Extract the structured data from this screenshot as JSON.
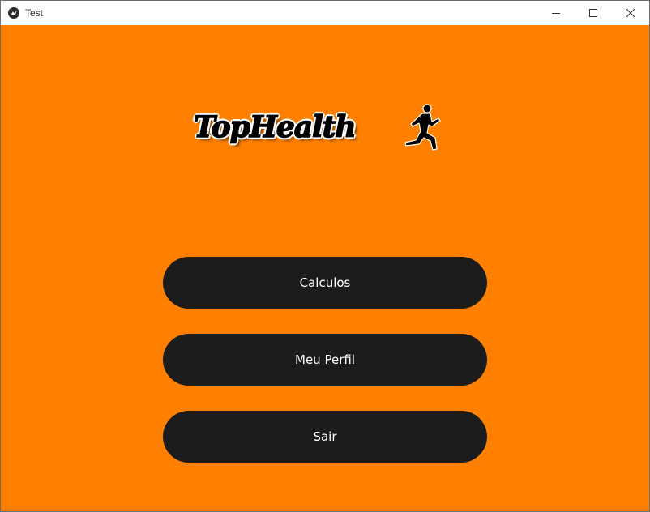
{
  "window": {
    "title": "Test",
    "app_icon": "kivy-icon",
    "controls": [
      "minimize-icon",
      "maximize-icon",
      "close-icon"
    ]
  },
  "colors": {
    "background": "#ff8000",
    "button": "#1c1c1c",
    "button_text": "#ffffff"
  },
  "logo": {
    "text": "TopHealth",
    "icon": "runner-icon"
  },
  "menu": {
    "buttons": [
      {
        "label": "Calculos"
      },
      {
        "label": "Meu Perfil"
      },
      {
        "label": "Sair"
      }
    ]
  }
}
